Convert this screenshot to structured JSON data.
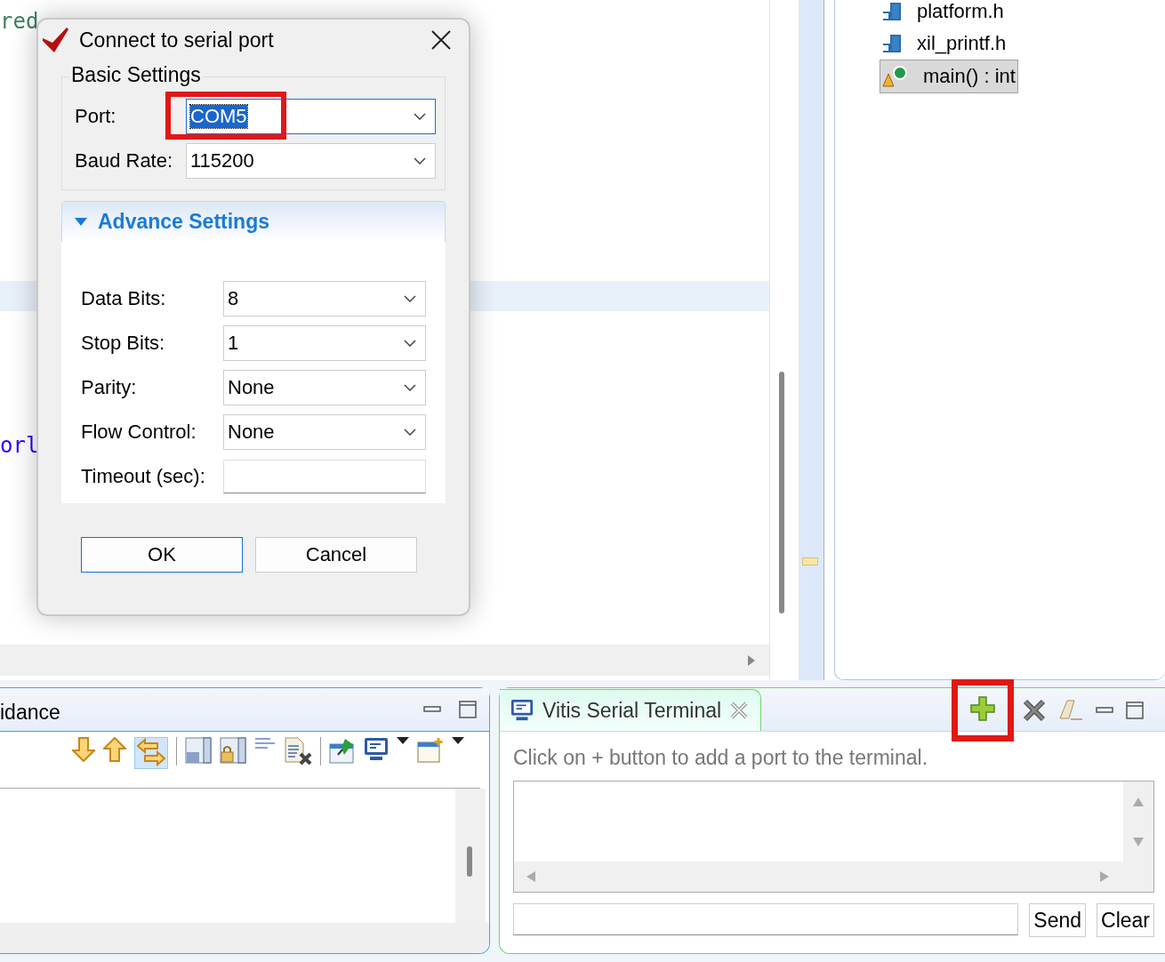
{
  "editor": {
    "code_lines": [
      {
        "text": "red",
        "kind": "comment"
      },
      {
        "text": "orl",
        "kind": "string"
      }
    ],
    "highlighted_line": true
  },
  "outline": {
    "items": [
      {
        "label": "platform.h",
        "kind": "header",
        "selected": false
      },
      {
        "label": "xil_printf.h",
        "kind": "header",
        "selected": false
      },
      {
        "label": "main() : int",
        "kind": "function",
        "selected": true
      }
    ]
  },
  "dialog": {
    "title": "Connect to serial port",
    "basic_settings": {
      "title": "Basic Settings",
      "fields": [
        {
          "label": "Port:",
          "value": "COM5",
          "focused": true,
          "highlighted": true
        },
        {
          "label": "Baud Rate:",
          "value": "115200",
          "focused": false,
          "highlighted": false
        }
      ]
    },
    "advance_settings": {
      "title": "Advance Settings",
      "expanded": true,
      "fields": [
        {
          "label": "Data Bits:",
          "value": "8",
          "kind": "dropdown"
        },
        {
          "label": "Stop Bits:",
          "value": "1",
          "kind": "dropdown"
        },
        {
          "label": "Parity:",
          "value": "None",
          "kind": "dropdown"
        },
        {
          "label": "Flow Control:",
          "value": "None",
          "kind": "dropdown"
        },
        {
          "label": "Timeout (sec):",
          "kind": "text"
        }
      ]
    },
    "buttons": [
      {
        "label": "OK",
        "default": true
      },
      {
        "label": "Cancel",
        "default": false
      }
    ]
  },
  "guidance_panel": {
    "title": "idance"
  },
  "terminal": {
    "tab": {
      "label": "Vitis Serial Terminal"
    },
    "add_button_highlighted": true,
    "hint": "Click on + button to add a port to the terminal.",
    "buttons": [
      {
        "label": "Send"
      },
      {
        "label": "Clear"
      }
    ]
  }
}
